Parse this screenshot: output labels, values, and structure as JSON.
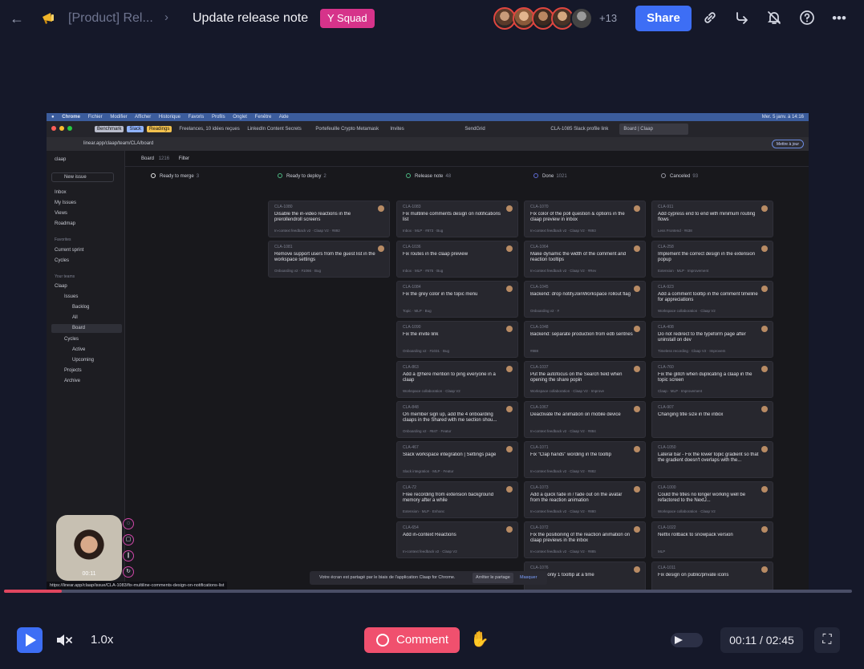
{
  "header": {
    "breadcrumb": "[Product] Rel...",
    "title": "Update release note",
    "squad": "Y Squad",
    "more_participants": "+13",
    "share_label": "Share"
  },
  "screen": {
    "menubar": [
      "Chrome",
      "Fichier",
      "Modifier",
      "Afficher",
      "Historique",
      "Favoris",
      "Profils",
      "Onglet",
      "Fenêtre",
      "Aide"
    ],
    "clock": "Mer. 5 janv. à 14:16",
    "tabs": [
      "Benchmark",
      "Slack",
      "Readings",
      "Freelances, 10 idées reçues",
      "LinkedIn Content Secrets",
      "Portefeuille Crypto Metamask",
      "Invites",
      "SendGrid",
      "CLA-1085 Slack profile link",
      "Board | Claap"
    ],
    "url": "linear.app/claap/team/CLA/board",
    "update_button": "Mettre à jour",
    "sidebar": {
      "workspace": "claap",
      "new_issue": "New issue",
      "items": [
        "Inbox",
        "My Issues",
        "Views",
        "Roadmap"
      ],
      "favorites_header": "Favorites",
      "favorites": [
        "Current sprint",
        "Cycles"
      ],
      "teams_header": "Your teams",
      "team": "Claap",
      "team_items": [
        "Issues",
        "Backlog",
        "All",
        "Board",
        "Cycles",
        "Active",
        "Upcoming",
        "Projects",
        "Archive"
      ]
    },
    "board": {
      "breadcrumb": "Board",
      "count": "1216",
      "filter": "Filter",
      "columns": [
        {
          "name": "Ready to merge",
          "count": "3",
          "color": "#e6e6e6",
          "cards": []
        },
        {
          "name": "Ready to deploy",
          "count": "2",
          "color": "#4cb782",
          "cards": [
            {
              "id": "CLA-1080",
              "title": "Disable the in-video reactions in the prerollendroll screens",
              "meta": "In-context feedback v2 · Claap V2 · #892"
            },
            {
              "id": "CLA-1081",
              "title": "Remove support users from the guest list in the workspace settings",
              "meta": "Onboarding v2 · #1066 · Bug"
            }
          ]
        },
        {
          "name": "Release note",
          "count": "48",
          "color": "#4cb782",
          "cards": [
            {
              "id": "CLA-1083",
              "title": "Fix multiline comments design on notifications list",
              "meta": "Inbox · MLP · #873 · Bug"
            },
            {
              "id": "CLA-1036",
              "title": "Fix routes in the claap preview",
              "meta": "Inbox · MLP · #675 · Bug"
            },
            {
              "id": "CLA-1084",
              "title": "Fix the grey color in the topic menu",
              "meta": "Topic · MLP · Bug"
            },
            {
              "id": "CLA-1090",
              "title": "Fix the invite link",
              "meta": "Onboarding v2 · #1031 · Bug"
            },
            {
              "id": "CLA-863",
              "title": "Add a @here mention to ping everyone in a claap",
              "meta": "Workspace collaboration · Claap V2"
            },
            {
              "id": "CLA-848",
              "title": "On member sign up, add the 4 onboarding claaps in the Shared with me section shou...",
              "meta": "Onboarding v2 · #847 · Featur"
            },
            {
              "id": "CLA-467",
              "title": "Slack workspace integration | Settings page",
              "meta": "Slack integration · MLP · Featur"
            },
            {
              "id": "CLA-72",
              "title": "Free recording from extension background memory after a while",
              "meta": "Extension · MLP · Enhanc"
            },
            {
              "id": "CLA-654",
              "title": "Add in-context Reactions",
              "meta": "In-context feedback v2 · Claap V2"
            }
          ]
        },
        {
          "name": "Done",
          "count": "1021",
          "color": "#5e6ad2",
          "cards": [
            {
              "id": "CLA-1070",
              "title": "Fix color of the poll question & options in the claap preview in inbox",
              "meta": "In-context feedback v2 · Claap V2 · #893"
            },
            {
              "id": "CLA-1064",
              "title": "Make dynamic the width of the comment and reaction tooltips",
              "meta": "In-context feedback v2 · Claap V2 · #Rev"
            },
            {
              "id": "CLA-1045",
              "title": "Backend: drop notifyJoinWorkspace rollout flag",
              "meta": "Onboarding v2 · #"
            },
            {
              "id": "CLA-1048",
              "title": "Backend: separate production from edb sentries",
              "meta": "#888"
            },
            {
              "id": "CLA-1037",
              "title": "Put the autofocus on the Search field when opening the share popin",
              "meta": "Workspace collaboration · Claap V2 · Improve"
            },
            {
              "id": "CLA-1067",
              "title": "Deactivate the animation on mobile device",
              "meta": "In-context feedback v2 · Claap V2 · #884"
            },
            {
              "id": "CLA-1071",
              "title": "Fix \"Clap hands\" wording in the tooltip",
              "meta": "In-context feedback v2 · Claap V2 · #882"
            },
            {
              "id": "CLA-1073",
              "title": "Add a quick fade in / fade out on the avatar from the reaction animation",
              "meta": "In-context feedback v2 · Claap V2 · #880"
            },
            {
              "id": "CLA-1072",
              "title": "Fix the positioning of the reaction animation on claap previews in the inbox",
              "meta": "In-context feedback v2 · Claap V2 · #885"
            },
            {
              "id": "CLA-1076",
              "title": "Display only 1 tooltip at a time",
              "meta": "In-context feedback v2 · Claap V2"
            }
          ]
        },
        {
          "name": "Canceled",
          "count": "93",
          "color": "#95959f",
          "cards": [
            {
              "id": "CLA-911",
              "title": "Add cypress end to end with minimum routing flows",
              "meta": "Less Frontend · #638"
            },
            {
              "id": "CLA-258",
              "title": "Implement the correct design in the extension popup",
              "meta": "Extension · MLP · Improvement"
            },
            {
              "id": "CLA-923",
              "title": "Add a comment tooltip in the comment timeline for appreciations",
              "meta": "Workspace collaboration · Claap V2"
            },
            {
              "id": "CLA-408",
              "title": "Do not redirect to the typeform page after uninstall on dev",
              "meta": "Timeless recording · Claap V2 · Improvem"
            },
            {
              "id": "CLA-760",
              "title": "Fix the glitch when duplicating a claap in the topic screen",
              "meta": "Claap · MLP · Improvement"
            },
            {
              "id": "CLA-907",
              "title": "Changing title size in the inbox",
              "meta": ""
            },
            {
              "id": "CLA-1050",
              "title": "Lateral bar - Fix the lower topic gradient so that the gradient doesn't overlaps with the...",
              "meta": ""
            },
            {
              "id": "CLA-1000",
              "title": "Could the titles no longer working well be refactored to the NextJ...",
              "meta": "Workspace collaboration · Claap V2"
            },
            {
              "id": "CLA-1022",
              "title": "Netfix rollback to snowpack version",
              "meta": "MLP"
            },
            {
              "id": "CLA-1011",
              "title": "Fix design on public/private icons",
              "meta": ""
            }
          ]
        }
      ]
    },
    "share_banner": "Votre écran est partagé par le biais de l'application Claap for Chrome.",
    "stop_sharing": "Arrêter le partage",
    "hide": "Masquer",
    "url_tooltip": "https://linear.app/claap/issue/CLA-1083/fix-multiline-comments-design-on-notifications-list",
    "webcam_time": "00:11"
  },
  "player": {
    "progress_fraction": 0.068,
    "speed": "1.0x",
    "comment_label": "Comment",
    "time": "00:11 / 02:45"
  },
  "colors": {
    "accent": "#3d6ef5",
    "comment": "#f0506e",
    "squad": "#d6338a"
  }
}
